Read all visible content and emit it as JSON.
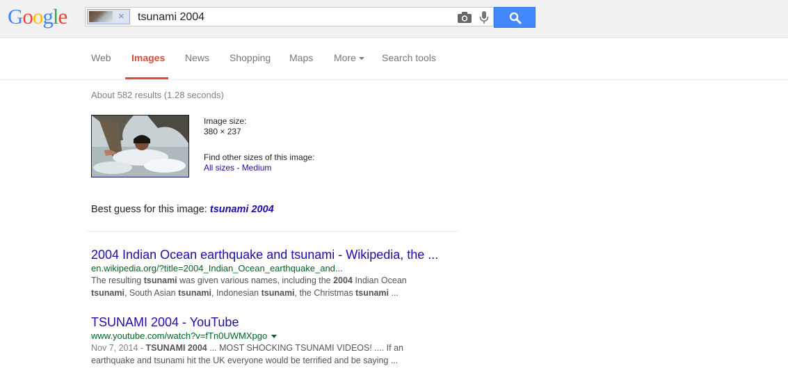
{
  "header": {
    "logo_letters": [
      "G",
      "o",
      "o",
      "g",
      "l",
      "e"
    ],
    "logo_colors": [
      "#4285f4",
      "#ea4335",
      "#fbbc05",
      "#4285f4",
      "#34a853",
      "#ea4335"
    ],
    "query": "tsunami 2004",
    "chip_close": "×"
  },
  "tabs": [
    {
      "label": "Web"
    },
    {
      "label": "Images"
    },
    {
      "label": "News"
    },
    {
      "label": "Shopping"
    },
    {
      "label": "Maps"
    },
    {
      "label": "More"
    },
    {
      "label": "Search tools"
    }
  ],
  "stats": "About 582 results (1.28 seconds)",
  "image_info": {
    "size_label": "Image size:",
    "size_value": "380 × 237",
    "other_sizes_label": "Find other sizes of this image:",
    "all_sizes": "All sizes",
    "separator": " - ",
    "medium": "Medium"
  },
  "best_guess": {
    "label": "Best guess for this image: ",
    "value": "tsunami 2004"
  },
  "results": [
    {
      "title": "2004 Indian Ocean earthquake and tsunami - Wikipedia, the ...",
      "url": "en.wikipedia.org/?title=2004_Indian_Ocean_earthquake_and...",
      "snippet_parts": [
        [
          "The resulting ",
          false
        ],
        [
          "tsunami",
          true
        ],
        [
          " was given various names, including the ",
          false
        ],
        [
          "2004",
          true
        ],
        [
          " Indian Ocean",
          false
        ],
        [
          "\n",
          false
        ],
        [
          "tsunami",
          true
        ],
        [
          ", South Asian ",
          false
        ],
        [
          "tsunami",
          true
        ],
        [
          ", Indonesian ",
          false
        ],
        [
          "tsunami",
          true
        ],
        [
          ", the Christmas ",
          false
        ],
        [
          "tsunami",
          true
        ],
        [
          " ...",
          false
        ]
      ]
    },
    {
      "title": "TSUNAMI 2004 - YouTube",
      "url": "www.youtube.com/watch?v=fTn0UWMXpgo",
      "date": "Nov 7, 2014 - ",
      "snippet_parts": [
        [
          "TSUNAMI 2004",
          true
        ],
        [
          " ... MOST SHOCKING TSUNAMI VIDEOS! .... If an",
          false
        ],
        [
          "\n",
          false
        ],
        [
          "earthquake and tsunami hit the UK everyone would be terrified and be saying ...",
          false
        ]
      ]
    }
  ]
}
